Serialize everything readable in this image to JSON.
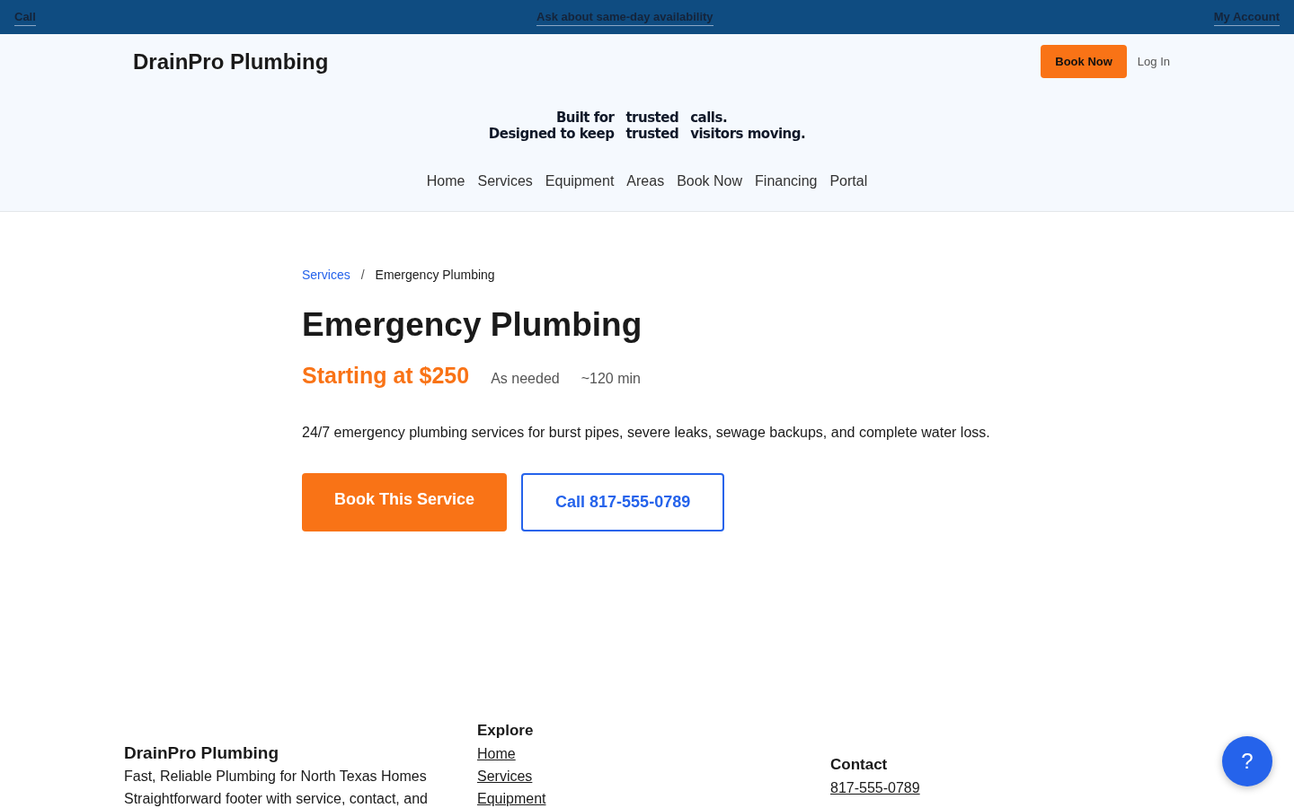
{
  "top_bar": {
    "left_link": "Call",
    "center_link": "Ask about same-day availability",
    "right_link": "My Account"
  },
  "header": {
    "brand": "DrainPro Plumbing",
    "book_button": "Book Now",
    "login_link": "Log In",
    "tagline": [
      [
        "Built for",
        "trusted",
        "calls."
      ],
      [
        "Designed to keep",
        "trusted",
        "visitors moving."
      ]
    ],
    "nav": [
      "Home",
      "Services",
      "Equipment",
      "Areas",
      "Book Now",
      "Financing",
      "Portal"
    ]
  },
  "breadcrumb": {
    "parent": "Services",
    "separator": "/",
    "current": "Emergency Plumbing"
  },
  "service": {
    "title": "Emergency Plumbing",
    "price": "Starting at $250",
    "frequency": "As needed",
    "duration": "~120 min",
    "description": "24/7 emergency plumbing services for burst pipes, severe leaks, sewage backups, and complete water loss.",
    "primary_button": "Book This Service",
    "secondary_button": "Call 817-555-0789"
  },
  "footer": {
    "brand": "DrainPro Plumbing",
    "lines": [
      "Fast, Reliable Plumbing for North Texas Homes",
      "Straightforward footer with service, contact, and"
    ],
    "explore_heading": "Explore",
    "explore_links": [
      "Home",
      "Services",
      "Equipment"
    ],
    "contact_heading": "Contact",
    "contact_links": [
      "817-555-0789"
    ]
  },
  "help_button": "?"
}
